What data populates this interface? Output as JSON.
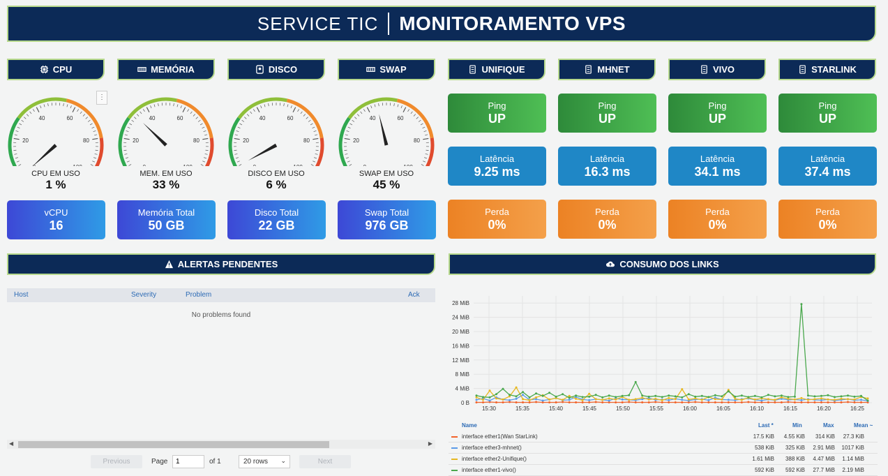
{
  "header": {
    "brand": "SERVICE TIC",
    "title": "MONITORAMENTO VPS"
  },
  "sections": {
    "cpu": "CPU",
    "memory": "MEMÓRIA",
    "disk": "DISCO",
    "swap": "SWAP",
    "unifique": "UNIFIQUE",
    "mhnet": "MHNET",
    "vivo": "VIVO",
    "starlink": "STARLINK",
    "alerts": "ALERTAS PENDENTES",
    "links": "CONSUMO DOS LINKS"
  },
  "gauges": [
    {
      "label": "CPU EM USO",
      "value": "1 %",
      "percent": 1
    },
    {
      "label": "MEM. EM USO",
      "value": "33 %",
      "percent": 33
    },
    {
      "label": "DISCO EM USO",
      "value": "6 %",
      "percent": 6
    },
    {
      "label": "SWAP EM USO",
      "value": "45 %",
      "percent": 45
    }
  ],
  "gauge_ticks": [
    "0",
    "20",
    "40",
    "60",
    "80",
    "100"
  ],
  "resources": [
    {
      "label": "vCPU",
      "value": "16"
    },
    {
      "label": "Memória Total",
      "value": "50 GB"
    },
    {
      "label": "Disco Total",
      "value": "22 GB"
    },
    {
      "label": "Swap Total",
      "value": "976 GB"
    }
  ],
  "links": [
    {
      "ping_label": "Ping",
      "ping": "UP",
      "lat_label": "Latência",
      "latency": "9.25 ms",
      "loss_label": "Perda",
      "loss": "0%"
    },
    {
      "ping_label": "Ping",
      "ping": "UP",
      "lat_label": "Latência",
      "latency": "16.3 ms",
      "loss_label": "Perda",
      "loss": "0%"
    },
    {
      "ping_label": "Ping",
      "ping": "UP",
      "lat_label": "Latência",
      "latency": "34.1 ms",
      "loss_label": "Perda",
      "loss": "0%"
    },
    {
      "ping_label": "Ping",
      "ping": "UP",
      "lat_label": "Latência",
      "latency": "37.4 ms",
      "loss_label": "Perda",
      "loss": "0%"
    }
  ],
  "alerts": {
    "columns": {
      "host": "Host",
      "severity": "Severity",
      "problem": "Problem",
      "ack": "Ack"
    },
    "empty": "No problems found",
    "pager": {
      "previous": "Previous",
      "page": "Page",
      "page_value": "1",
      "of": "of 1",
      "rows": "20 rows",
      "next": "Next"
    }
  },
  "chart_data": {
    "type": "line",
    "x": [
      "15:30",
      "15:35",
      "15:40",
      "15:45",
      "15:50",
      "15:55",
      "16:00",
      "16:05",
      "16:10",
      "16:15",
      "16:20",
      "16:25"
    ],
    "yticks": [
      "0 B",
      "4 MiB",
      "8 MiB",
      "12 MiB",
      "16 MiB",
      "20 MiB",
      "24 MiB",
      "28 MiB"
    ],
    "ylim": [
      0,
      30
    ],
    "series": [
      {
        "name": "interface ether1(Wan StarLink)",
        "color": "#f2632b",
        "last": "17.5 KiB",
        "min": "4.55 KiB",
        "max": "314 KiB",
        "mean": "27.3 KiB",
        "values": [
          0.1,
          0.1,
          0.2,
          0.1,
          0.1,
          0.2,
          0.1,
          0.1,
          0.1,
          0.2,
          0.1,
          0.1,
          0.1,
          0.2,
          0.1,
          0.1,
          0.1,
          0.1,
          0.2,
          0.1,
          0.1,
          0.1,
          0.1,
          0.2,
          0.1,
          0.1,
          0.1,
          0.2,
          0.1,
          0.1,
          0.1,
          0.1,
          0.1,
          0.2,
          0.1,
          0.1,
          0.1,
          0.1,
          0.1,
          0.1,
          0.1,
          0.2,
          0.1,
          0.1,
          0.1,
          0.1,
          0.1,
          0.2,
          0.1,
          0.1,
          0.1,
          0.1,
          0.1,
          0.1,
          0.1,
          0.1,
          0.2,
          0.1,
          0.1,
          0.1
        ]
      },
      {
        "name": "interface ether3-mhnet()",
        "color": "#5b9be8",
        "last": "538 KiB",
        "min": "325 KiB",
        "max": "2.91 MiB",
        "mean": "1017 KiB",
        "values": [
          0.8,
          1.2,
          0.6,
          1.5,
          0.9,
          0.7,
          1.1,
          2.2,
          0.8,
          1.0,
          0.6,
          0.9,
          1.3,
          0.7,
          0.8,
          1.6,
          0.9,
          0.7,
          1.0,
          0.8,
          0.6,
          1.2,
          0.9,
          0.8,
          0.7,
          1.0,
          1.3,
          0.8,
          0.9,
          0.7,
          1.1,
          0.8,
          0.6,
          0.9,
          1.0,
          0.7,
          1.4,
          0.9,
          0.8,
          0.7,
          1.0,
          1.2,
          0.8,
          0.6,
          0.9,
          0.7,
          1.1,
          0.8,
          0.9,
          0.7,
          1.0,
          0.8,
          0.7,
          0.9,
          0.6,
          0.8,
          1.0,
          0.7,
          0.8,
          0.5
        ]
      },
      {
        "name": "interface ether2-Unifique()",
        "color": "#e6b822",
        "last": "1.61 MiB",
        "min": "388 KiB",
        "max": "4.47 MiB",
        "mean": "1.14 MiB",
        "values": [
          1.5,
          0.8,
          3.4,
          1.2,
          0.9,
          1.8,
          4.3,
          1.0,
          0.7,
          1.5,
          2.1,
          0.9,
          1.3,
          0.8,
          1.9,
          1.1,
          0.7,
          2.5,
          1.0,
          0.8,
          1.2,
          0.9,
          1.6,
          0.8,
          1.0,
          1.4,
          0.9,
          1.1,
          0.7,
          1.3,
          1.0,
          3.8,
          0.9,
          1.2,
          0.8,
          1.6,
          1.0,
          0.9,
          3.6,
          1.1,
          0.8,
          1.4,
          0.9,
          1.2,
          1.0,
          0.8,
          1.5,
          1.1,
          0.9,
          1.3,
          0.8,
          1.0,
          1.2,
          0.9,
          0.8,
          1.1,
          1.0,
          0.9,
          1.6,
          1.2
        ]
      },
      {
        "name": "interface ether1-vivo()",
        "color": "#4aa84d",
        "last": "592 KiB",
        "min": "592 KiB",
        "max": "27.7 MiB",
        "mean": "2.19 MiB",
        "values": [
          2.0,
          1.6,
          1.5,
          2.4,
          3.9,
          2.2,
          1.8,
          3.0,
          1.5,
          2.6,
          1.9,
          2.8,
          1.7,
          2.4,
          1.4,
          2.0,
          1.6,
          1.7,
          2.2,
          1.5,
          2.0,
          1.6,
          1.9,
          2.1,
          5.8,
          2.0,
          1.7,
          1.9,
          1.6,
          2.0,
          1.8,
          1.5,
          2.4,
          1.7,
          1.9,
          1.6,
          2.1,
          1.8,
          3.2,
          1.7,
          2.0,
          1.6,
          1.9,
          1.5,
          2.2,
          1.8,
          2.0,
          1.6,
          1.7,
          27.7,
          2.0,
          1.8,
          1.9,
          2.1,
          1.6,
          1.8,
          2.0,
          1.7,
          1.9,
          0.6
        ]
      }
    ],
    "legend_headers": {
      "name": "Name",
      "last": "Last *",
      "min": "Min",
      "max": "Max",
      "mean": "Mean ~"
    }
  }
}
